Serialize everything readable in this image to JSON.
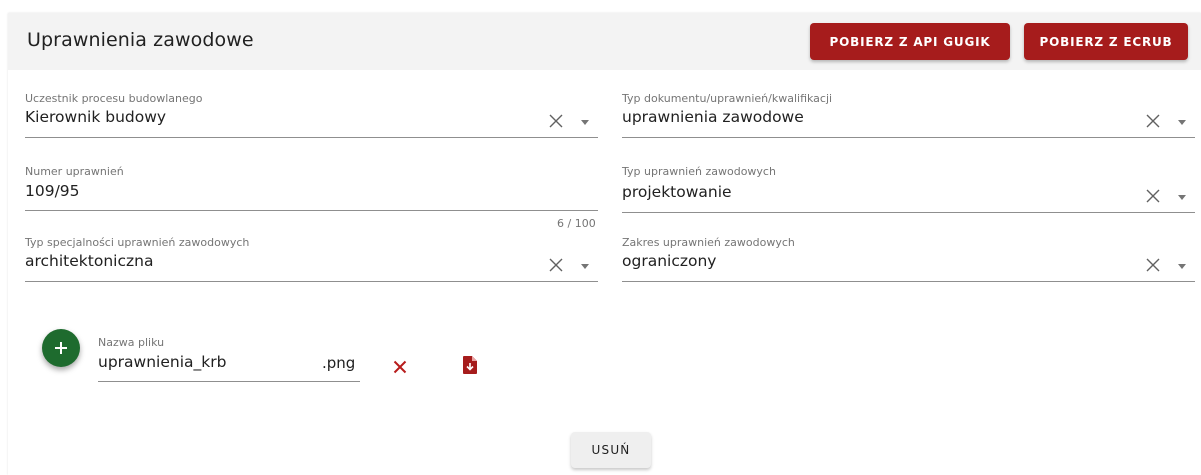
{
  "header": {
    "title": "Uprawnienia zawodowe",
    "btn_gugik": "POBIERZ Z API GUGIK",
    "btn_ecrub": "POBIERZ Z ECRUB"
  },
  "fields": {
    "uczestnik": {
      "label": "Uczestnik procesu budowlanego",
      "value": "Kierownik budowy"
    },
    "typ_dokumentu": {
      "label": "Typ dokumentu/uprawnień/kwalifikacji",
      "value": "uprawnienia zawodowe"
    },
    "numer": {
      "label": "Numer uprawnień",
      "value": "109/95",
      "counter": "6 / 100"
    },
    "typ_uprawnien": {
      "label": "Typ uprawnień zawodowych",
      "value": "projektowanie"
    },
    "typ_specjalnosci": {
      "label": "Typ specjalności uprawnień zawodowych",
      "value": "architektoniczna"
    },
    "zakres": {
      "label": "Zakres uprawnień zawodowych",
      "value": "ograniczony"
    }
  },
  "file": {
    "label": "Nazwa pliku",
    "name": "uprawnienia_krb",
    "ext": ".png"
  },
  "footer": {
    "delete_label": "USUŃ"
  },
  "colors": {
    "accent_red": "#a61c1c",
    "fab_green": "#1e6b2e",
    "header_bg": "#f3f3f3"
  },
  "icons": {
    "fab": "plus-icon",
    "remove_file": "close-icon",
    "download_file": "file-download-icon",
    "clear": "close-icon",
    "dropdown": "arrow-down-icon"
  }
}
